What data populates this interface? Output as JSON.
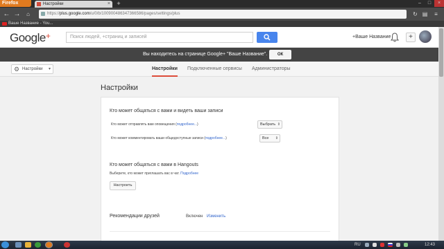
{
  "browser": {
    "menu_label": "Firefox",
    "tab_title": "Настройки",
    "url_host": "plus.google.com",
    "url_prefix": "https://",
    "url_path": "/u/0/b/100900486347366586/pages/settings/plus",
    "bookmark": "Ваше Название - You..."
  },
  "header": {
    "logo_text": "Google",
    "logo_plus": "+",
    "search_placeholder": "Поиск людей, +страниц и записей",
    "page_link": "+Ваше Название"
  },
  "banner": {
    "message": "Вы находитесь на странице Google+ \"Ваше Название\".",
    "ok_label": "ОК"
  },
  "subnav": {
    "dropdown_label": "Настройки",
    "tabs": [
      {
        "label": "Настройки",
        "active": true
      },
      {
        "label": "Подключенные сервисы",
        "active": false
      },
      {
        "label": "Администраторы",
        "active": false
      }
    ]
  },
  "settings": {
    "title": "Настройки",
    "section1": {
      "heading": "Кто может общаться с вами и видеть ваши записи",
      "row1_text": "Кто может отправлять вам оповещения (",
      "row1_link": "подробнее...",
      "row1_close": ")",
      "row1_value": "Выбрать",
      "row2_text": "Кто может комментировать ваши общедоступные записи (",
      "row2_link": "подробнее...",
      "row2_close": ")",
      "row2_value": "Все"
    },
    "section2": {
      "heading": "Кто может общаться с вами в Hangouts",
      "desc": "Выберите, кто может приглашать вас в чат.",
      "link": "Подробнее",
      "button": "Настроить"
    },
    "section3": {
      "heading": "Рекомендации друзей",
      "status": "Включен",
      "link": "Изменить"
    }
  },
  "taskbar": {
    "lang": "RU",
    "time": "12:43"
  },
  "colors": {
    "brand_red": "#dd4b39",
    "link_blue": "#3366cc",
    "search_blue": "#4885ed",
    "firefox_orange": "#e07a1f"
  }
}
